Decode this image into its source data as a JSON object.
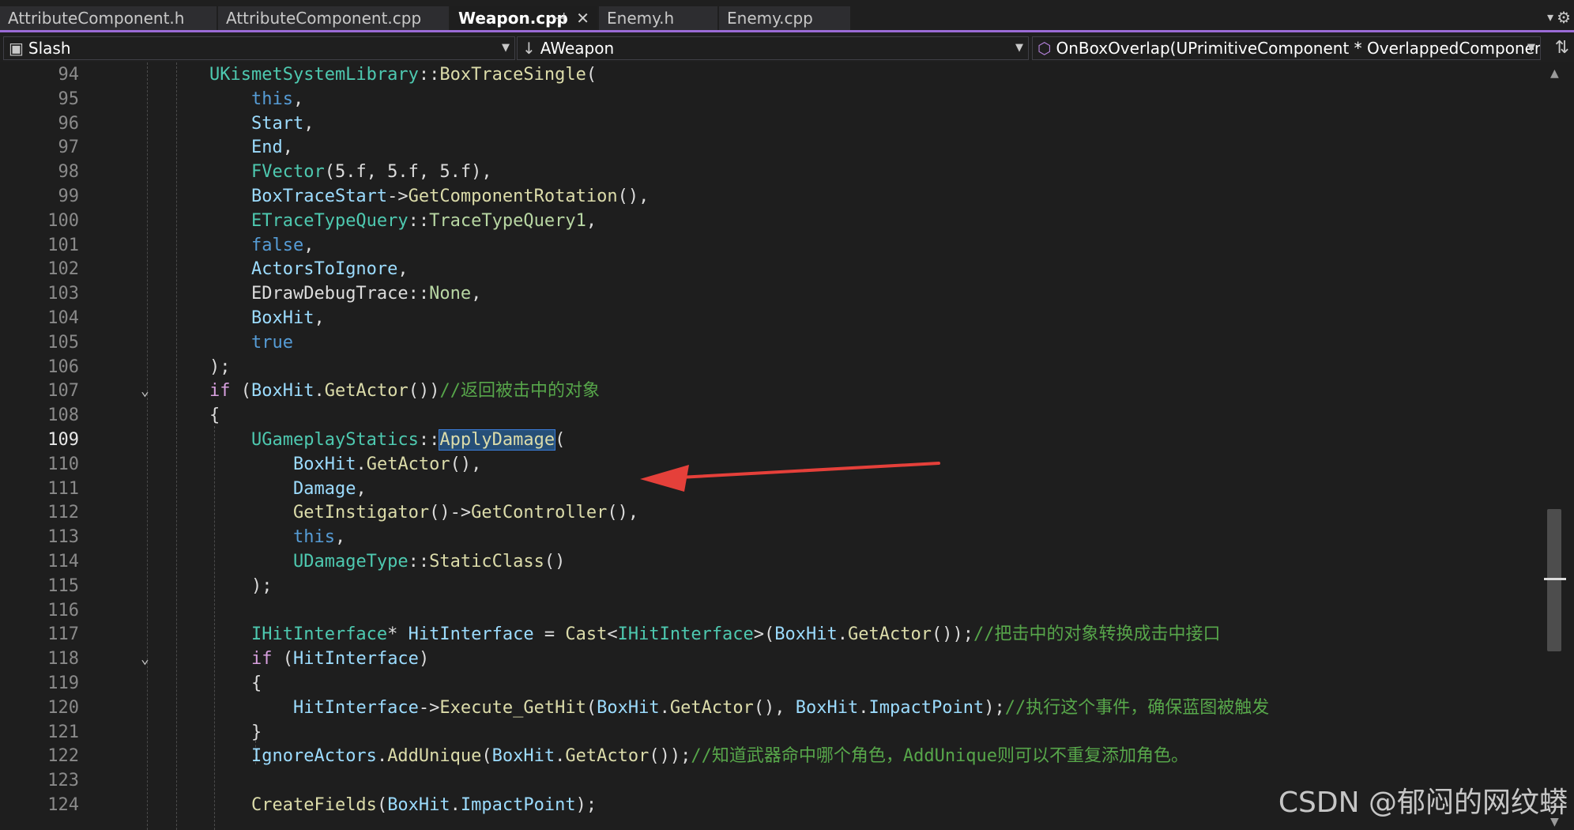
{
  "tabs": [
    {
      "label": "AttributeComponent.h"
    },
    {
      "label": "AttributeComponent.cpp"
    },
    {
      "label": "Weapon.cpp",
      "active": true,
      "pin": "⊣",
      "close": "✕"
    },
    {
      "label": "Enemy.h"
    },
    {
      "label": "Enemy.cpp"
    }
  ],
  "navbar": {
    "project": "Slash",
    "class": "AWeapon",
    "member": "OnBoxOverlap(UPrimitiveComponent * OverlappedComponent, AAct"
  },
  "icons": {
    "dropdown": "chevron-down-icon",
    "settings": "gear-icon",
    "split": "split-editor-icon",
    "class": "down-arrow-icon",
    "member": "method-cube-icon"
  },
  "colors": {
    "accent": "#9b6bd6",
    "keyword": "#569cd6",
    "type": "#4ec9b0",
    "function": "#dcdcaa",
    "variable": "#9cdcfe",
    "comment": "#57a64a",
    "arrow": "#e5403a"
  },
  "editor": {
    "current_line": 109,
    "lines": [
      {
        "n": 94,
        "fold": "",
        "tokens": [
          [
            "t-type",
            "UKismetSystemLibrary"
          ],
          [
            "t-pl",
            "::"
          ],
          [
            "t-fn",
            "BoxTraceSingle"
          ],
          [
            "t-pl",
            "("
          ]
        ]
      },
      {
        "n": 95,
        "fold": "",
        "tokens": [
          [
            "t-pl",
            "    "
          ],
          [
            "t-kw",
            "this"
          ],
          [
            "t-pl",
            ","
          ]
        ]
      },
      {
        "n": 96,
        "fold": "",
        "tokens": [
          [
            "t-pl",
            "    "
          ],
          [
            "t-var",
            "Start"
          ],
          [
            "t-pl",
            ","
          ]
        ]
      },
      {
        "n": 97,
        "fold": "",
        "tokens": [
          [
            "t-pl",
            "    "
          ],
          [
            "t-var",
            "End"
          ],
          [
            "t-pl",
            ","
          ]
        ]
      },
      {
        "n": 98,
        "fold": "",
        "tokens": [
          [
            "t-pl",
            "    "
          ],
          [
            "t-type",
            "FVector"
          ],
          [
            "t-pl",
            "(5.f, 5.f, 5.f),"
          ]
        ]
      },
      {
        "n": 99,
        "fold": "",
        "tokens": [
          [
            "t-pl",
            "    "
          ],
          [
            "t-var",
            "BoxTraceStart"
          ],
          [
            "t-pl",
            "->"
          ],
          [
            "t-fn",
            "GetComponentRotation"
          ],
          [
            "t-pl",
            "(),"
          ]
        ]
      },
      {
        "n": 100,
        "fold": "",
        "tokens": [
          [
            "t-pl",
            "    "
          ],
          [
            "t-type",
            "ETraceTypeQuery"
          ],
          [
            "t-pl",
            "::"
          ],
          [
            "t-enum",
            "TraceTypeQuery1"
          ],
          [
            "t-pl",
            ","
          ]
        ]
      },
      {
        "n": 101,
        "fold": "",
        "tokens": [
          [
            "t-pl",
            "    "
          ],
          [
            "t-kw",
            "false"
          ],
          [
            "t-pl",
            ","
          ]
        ]
      },
      {
        "n": 102,
        "fold": "",
        "tokens": [
          [
            "t-pl",
            "    "
          ],
          [
            "t-var",
            "ActorsToIgnore"
          ],
          [
            "t-pl",
            ","
          ]
        ]
      },
      {
        "n": 103,
        "fold": "",
        "tokens": [
          [
            "t-pl",
            "    "
          ],
          [
            "t-pl",
            "EDrawDebugTrace"
          ],
          [
            "t-pl",
            "::"
          ],
          [
            "t-enum",
            "None"
          ],
          [
            "t-pl",
            ","
          ]
        ]
      },
      {
        "n": 104,
        "fold": "",
        "tokens": [
          [
            "t-pl",
            "    "
          ],
          [
            "t-var",
            "BoxHit"
          ],
          [
            "t-pl",
            ","
          ]
        ]
      },
      {
        "n": 105,
        "fold": "",
        "tokens": [
          [
            "t-pl",
            "    "
          ],
          [
            "t-kw",
            "true"
          ]
        ]
      },
      {
        "n": 106,
        "fold": "",
        "tokens": [
          [
            "t-pl",
            ");"
          ]
        ]
      },
      {
        "n": 107,
        "fold": "⌄",
        "tokens": [
          [
            "t-kw2",
            "if"
          ],
          [
            "t-pl",
            " ("
          ],
          [
            "t-var",
            "BoxHit"
          ],
          [
            "t-pl",
            "."
          ],
          [
            "t-fn",
            "GetActor"
          ],
          [
            "t-pl",
            "())"
          ],
          [
            "t-com",
            "//返回被击中的对象"
          ]
        ]
      },
      {
        "n": 108,
        "fold": "",
        "tokens": [
          [
            "t-pl",
            "{"
          ]
        ]
      },
      {
        "n": 109,
        "fold": "",
        "tokens": [
          [
            "t-pl",
            "    "
          ],
          [
            "t-type",
            "UGameplayStatics"
          ],
          [
            "t-pl",
            "::"
          ],
          [
            "t-fn hl",
            "ApplyDamage"
          ],
          [
            "t-pl",
            "("
          ]
        ]
      },
      {
        "n": 110,
        "fold": "",
        "tokens": [
          [
            "t-pl",
            "        "
          ],
          [
            "t-var",
            "BoxHit"
          ],
          [
            "t-pl",
            "."
          ],
          [
            "t-fn",
            "GetActor"
          ],
          [
            "t-pl",
            "(),"
          ]
        ]
      },
      {
        "n": 111,
        "fold": "",
        "tokens": [
          [
            "t-pl",
            "        "
          ],
          [
            "t-var",
            "Damage"
          ],
          [
            "t-pl",
            ","
          ]
        ]
      },
      {
        "n": 112,
        "fold": "",
        "tokens": [
          [
            "t-pl",
            "        "
          ],
          [
            "t-fn",
            "GetInstigator"
          ],
          [
            "t-pl",
            "()->"
          ],
          [
            "t-fn",
            "GetController"
          ],
          [
            "t-pl",
            "(),"
          ]
        ]
      },
      {
        "n": 113,
        "fold": "",
        "tokens": [
          [
            "t-pl",
            "        "
          ],
          [
            "t-kw",
            "this"
          ],
          [
            "t-pl",
            ","
          ]
        ]
      },
      {
        "n": 114,
        "fold": "",
        "tokens": [
          [
            "t-pl",
            "        "
          ],
          [
            "t-type",
            "UDamageType"
          ],
          [
            "t-pl",
            "::"
          ],
          [
            "t-fn",
            "StaticClass"
          ],
          [
            "t-pl",
            "()"
          ]
        ]
      },
      {
        "n": 115,
        "fold": "",
        "tokens": [
          [
            "t-pl",
            "    );"
          ]
        ]
      },
      {
        "n": 116,
        "fold": "",
        "tokens": []
      },
      {
        "n": 117,
        "fold": "",
        "tokens": [
          [
            "t-pl",
            "    "
          ],
          [
            "t-type",
            "IHitInterface"
          ],
          [
            "t-pl",
            "* "
          ],
          [
            "t-var",
            "HitInterface"
          ],
          [
            "t-pl",
            " = "
          ],
          [
            "t-fn",
            "Cast"
          ],
          [
            "t-pl",
            "<"
          ],
          [
            "t-type",
            "IHitInterface"
          ],
          [
            "t-pl",
            ">("
          ],
          [
            "t-var",
            "BoxHit"
          ],
          [
            "t-pl",
            "."
          ],
          [
            "t-fn",
            "GetActor"
          ],
          [
            "t-pl",
            "());"
          ],
          [
            "t-com",
            "//把击中的对象转换成击中接口"
          ]
        ]
      },
      {
        "n": 118,
        "fold": "⌄",
        "tokens": [
          [
            "t-pl",
            "    "
          ],
          [
            "t-kw2",
            "if"
          ],
          [
            "t-pl",
            " ("
          ],
          [
            "t-var",
            "HitInterface"
          ],
          [
            "t-pl",
            ")"
          ]
        ]
      },
      {
        "n": 119,
        "fold": "",
        "tokens": [
          [
            "t-pl",
            "    {"
          ]
        ]
      },
      {
        "n": 120,
        "fold": "",
        "tokens": [
          [
            "t-pl",
            "        "
          ],
          [
            "t-var",
            "HitInterface"
          ],
          [
            "t-pl",
            "->"
          ],
          [
            "t-fn",
            "Execute_GetHit"
          ],
          [
            "t-pl",
            "("
          ],
          [
            "t-var",
            "BoxHit"
          ],
          [
            "t-pl",
            "."
          ],
          [
            "t-fn",
            "GetActor"
          ],
          [
            "t-pl",
            "(), "
          ],
          [
            "t-var",
            "BoxHit"
          ],
          [
            "t-pl",
            "."
          ],
          [
            "t-var",
            "ImpactPoint"
          ],
          [
            "t-pl",
            ");"
          ],
          [
            "t-com",
            "//执行这个事件，确保蓝图被触发"
          ]
        ]
      },
      {
        "n": 121,
        "fold": "",
        "tokens": [
          [
            "t-pl",
            "    }"
          ]
        ]
      },
      {
        "n": 122,
        "fold": "",
        "tokens": [
          [
            "t-pl",
            "    "
          ],
          [
            "t-var",
            "IgnoreActors"
          ],
          [
            "t-pl",
            "."
          ],
          [
            "t-fn",
            "AddUnique"
          ],
          [
            "t-pl",
            "("
          ],
          [
            "t-var",
            "BoxHit"
          ],
          [
            "t-pl",
            "."
          ],
          [
            "t-fn",
            "GetActor"
          ],
          [
            "t-pl",
            "());"
          ],
          [
            "t-com",
            "//知道武器命中哪个角色，AddUnique则可以不重复添加角色。"
          ]
        ]
      },
      {
        "n": 123,
        "fold": "",
        "tokens": []
      },
      {
        "n": 124,
        "fold": "",
        "tokens": [
          [
            "t-pl",
            "    "
          ],
          [
            "t-fn",
            "CreateFields"
          ],
          [
            "t-pl",
            "("
          ],
          [
            "t-var",
            "BoxHit"
          ],
          [
            "t-pl",
            "."
          ],
          [
            "t-var",
            "ImpactPoint"
          ],
          [
            "t-pl",
            ");"
          ]
        ]
      }
    ]
  },
  "watermark": "CSDN @郁闷的网纹蟒"
}
